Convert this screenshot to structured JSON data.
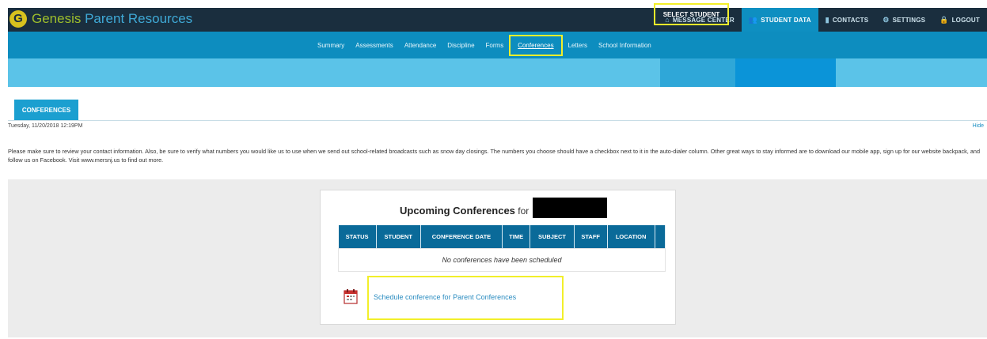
{
  "app": {
    "logo_letter": "G",
    "brand_first": "Genesis",
    "brand_rest": " Parent Resources"
  },
  "topnav": [
    {
      "label": "MESSAGE CENTER",
      "icon": "home-icon",
      "glyph": "⌂",
      "active": false
    },
    {
      "label": "STUDENT DATA",
      "icon": "students-icon",
      "glyph": "👥",
      "active": true
    },
    {
      "label": "CONTACTS",
      "icon": "contacts-icon",
      "glyph": "▮",
      "active": false
    },
    {
      "label": "SETTINGS",
      "icon": "gear-icon",
      "glyph": "⚙",
      "active": false
    },
    {
      "label": "LOGOUT",
      "icon": "lock-icon",
      "glyph": "🔒",
      "active": false
    }
  ],
  "subnav": [
    {
      "label": "Summary",
      "selected": false
    },
    {
      "label": "Assessments",
      "selected": false
    },
    {
      "label": "Attendance",
      "selected": false
    },
    {
      "label": "Discipline",
      "selected": false
    },
    {
      "label": "Forms",
      "selected": false
    },
    {
      "label": "Conferences",
      "selected": true
    },
    {
      "label": "Letters",
      "selected": false
    },
    {
      "label": "School Information",
      "selected": false
    }
  ],
  "student_bar": {
    "select_label": "SELECT STUDENT"
  },
  "page": {
    "tab_label": "CONFERENCES",
    "datetime": "Tuesday, 11/20/2018 12:19PM",
    "hide_label": "Hide",
    "info_text": "Please make sure to review your contact information. Also, be sure to verify what numbers you would like us to use when we send out school-related broadcasts such as snow day closings. The numbers you choose should have a checkbox next to it in the auto-dialer column. Other great ways to stay informed are to download our mobile app, sign up for our website backpack, and follow us on Facebook. Visit www.mersnj.us to find out more."
  },
  "conferences": {
    "title": "Upcoming Conferences",
    "title_for": " for",
    "columns": [
      "STATUS",
      "STUDENT",
      "CONFERENCE DATE",
      "TIME",
      "SUBJECT",
      "STAFF",
      "LOCATION"
    ],
    "empty_message": "No conferences have been scheduled",
    "schedule_link": "Schedule conference for Parent Conferences"
  },
  "colors": {
    "topbar": "#1a2e3e",
    "subnav": "#0d8dbf",
    "student_bar": "#5bc3e8",
    "highlight": "#f2ef2a",
    "table_header": "#0a6a99"
  }
}
